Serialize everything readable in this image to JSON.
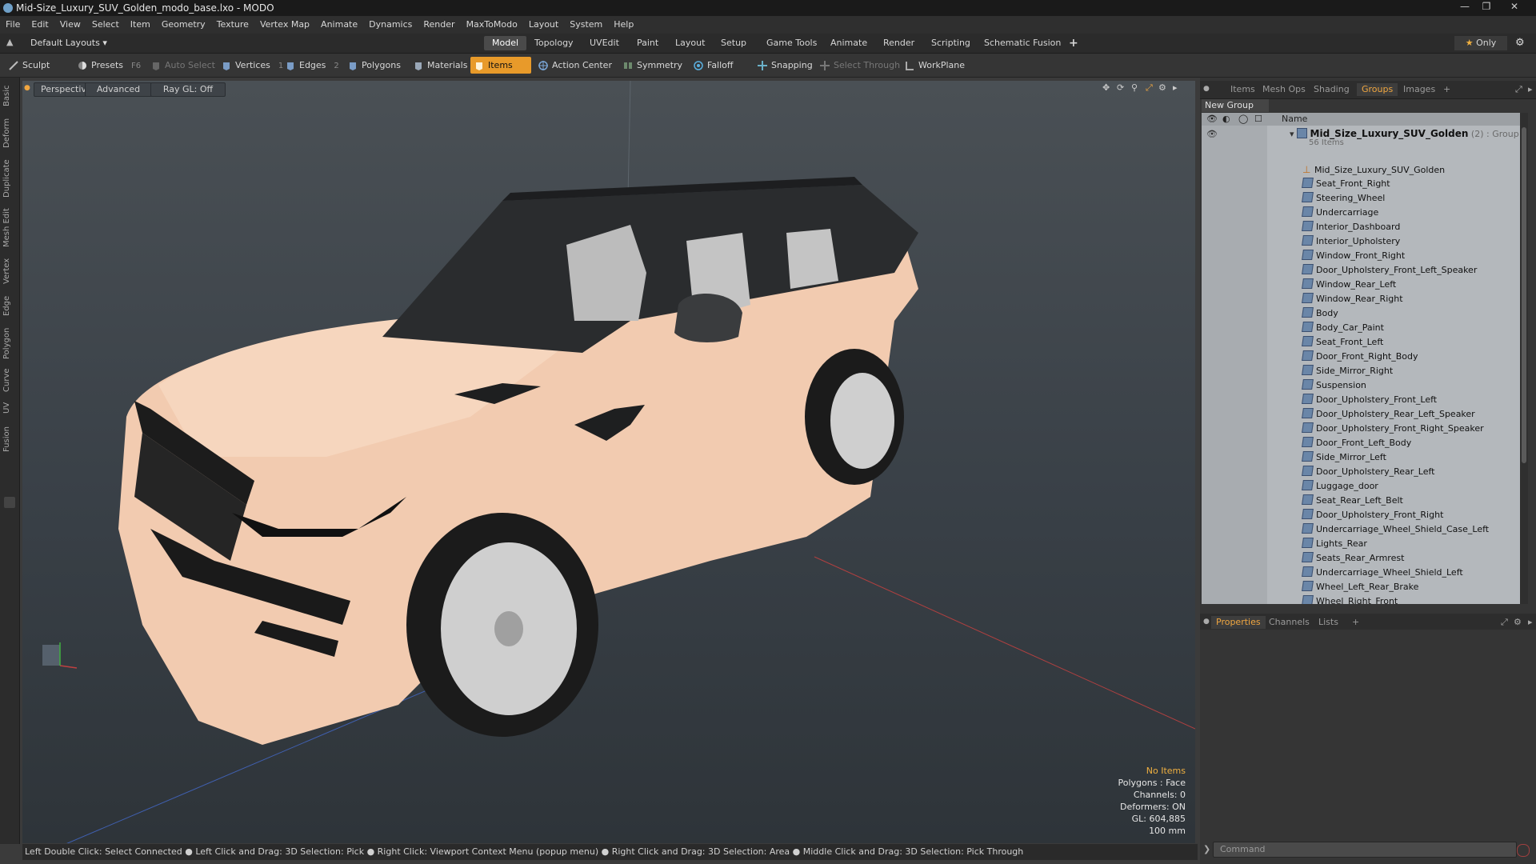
{
  "window": {
    "title": "Mid-Size_Luxury_SUV_Golden_modo_base.lxo - MODO"
  },
  "menu": [
    "File",
    "Edit",
    "View",
    "Select",
    "Item",
    "Geometry",
    "Texture",
    "Vertex Map",
    "Animate",
    "Dynamics",
    "Render",
    "MaxToModo",
    "Layout",
    "System",
    "Help"
  ],
  "layout_selector": "Default Layouts",
  "layout_tabs": [
    "Model",
    "Topology",
    "UVEdit",
    "Paint",
    "Layout",
    "Setup",
    "Game Tools",
    "Animate",
    "Render",
    "Scripting",
    "Schematic Fusion"
  ],
  "active_layout_tab": "Model",
  "only_label": "Only",
  "toolbar": {
    "sculpt": "Sculpt",
    "presets": "Presets",
    "presets_hint": "F6",
    "auto_select": "Auto Select",
    "vertices": "Vertices",
    "vertices_hint": "1",
    "edges": "Edges",
    "edges_hint": "2",
    "polygons": "Polygons",
    "materials": "Materials",
    "items": "Items",
    "action_center": "Action Center",
    "symmetry": "Symmetry",
    "falloff": "Falloff",
    "snapping": "Snapping",
    "select_through": "Select Through",
    "workplane": "WorkPlane"
  },
  "left_tabs": [
    "Basic",
    "Deform",
    "Duplicate",
    "Mesh Edit",
    "Vertex",
    "Edge",
    "Polygon",
    "Curve",
    "UV",
    "Fusion"
  ],
  "viewport": {
    "view": "Perspective",
    "shading": "Advanced",
    "raygl": "Ray GL: Off",
    "info": {
      "selection": "No Items",
      "polygons": "Polygons : Face",
      "channels": "Channels: 0",
      "deformers": "Deformers: ON",
      "gl": "GL: 604,885",
      "unit": "100 mm"
    }
  },
  "statusbar": "Left Double Click: Select Connected ● Left Click and Drag: 3D Selection: Pick ● Right Click: Viewport Context Menu (popup menu) ● Right Click and Drag: 3D Selection: Area ● Middle Click and Drag: 3D Selection: Pick Through",
  "panel_tabs_top": [
    "Items",
    "Mesh Ops",
    "Shading",
    "Groups",
    "Images"
  ],
  "active_panel_tab": "Groups",
  "groups": {
    "new_group": "New Group",
    "column_name": "Name",
    "group_name": "Mid_Size_Luxury_SUV_Golden",
    "group_suffix": "(2) : Group",
    "group_count": "56 Items",
    "items": [
      "Mid_Size_Luxury_SUV_Golden",
      "Seat_Front_Right",
      "Steering_Wheel",
      "Undercarriage",
      "Interior_Dashboard",
      "Interior_Upholstery",
      "Window_Front_Right",
      "Door_Upholstery_Front_Left_Speaker",
      "Window_Rear_Left",
      "Window_Rear_Right",
      "Body",
      "Body_Car_Paint",
      "Seat_Front_Left",
      "Door_Front_Right_Body",
      "Side_Mirror_Right",
      "Suspension",
      "Door_Upholstery_Front_Left",
      "Door_Upholstery_Rear_Left_Speaker",
      "Door_Upholstery_Front_Right_Speaker",
      "Door_Front_Left_Body",
      "Side_Mirror_Left",
      "Door_Upholstery_Rear_Left",
      "Luggage_door",
      "Seat_Rear_Left_Belt",
      "Door_Upholstery_Front_Right",
      "Undercarriage_Wheel_Shield_Case_Left",
      "Lights_Rear",
      "Seats_Rear_Armrest",
      "Undercarriage_Wheel_Shield_Left",
      "Wheel_Left_Rear_Brake",
      "Wheel_Right_Front"
    ]
  },
  "panel_tabs_bottom": [
    "Properties",
    "Channels",
    "Lists"
  ],
  "active_bottom_tab": "Properties",
  "command_placeholder": "Command",
  "colors": {
    "accent": "#e89a2a",
    "viewport_top": "#4a5055",
    "panel": "#353535"
  }
}
